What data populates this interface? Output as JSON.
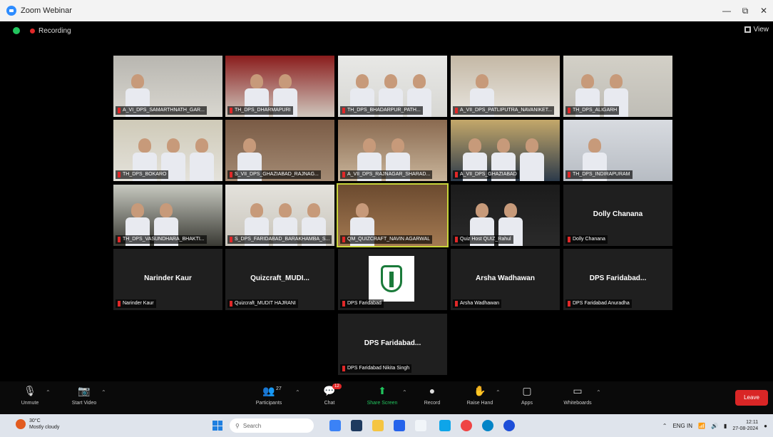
{
  "window": {
    "title": "Zoom Webinar",
    "controls": [
      "—",
      "⧉",
      "✕"
    ]
  },
  "topbar": {
    "recording_label": "Recording",
    "view_label": "View"
  },
  "tiles": [
    {
      "name": "A_VI_DPS_SAMARTHNATH_GAR...",
      "type": "video"
    },
    {
      "name": "TH_DPS_DHARMAPURI",
      "type": "video"
    },
    {
      "name": "TH_DPS_BHADARPUR_PATH...",
      "type": "video"
    },
    {
      "name": "A_VII_DPS_PATLIPUTRA_NAVANIKET...",
      "type": "video"
    },
    {
      "name": "TH_DPS_ALIGARH",
      "type": "video"
    },
    {
      "name": "TH_DPS_BOKARO",
      "type": "video"
    },
    {
      "name": "S_VII_DPS_GHAZIABAD_RAJNAG...",
      "type": "video"
    },
    {
      "name": "A_VII_DPS_RAJNAGAR_SHARAD...",
      "type": "video"
    },
    {
      "name": "A_VII_DPS_GHAZIABAD",
      "type": "video"
    },
    {
      "name": "TH_DPS_INDIRAPURAM",
      "type": "video"
    },
    {
      "name": "TH_DPS_VASUNDHARA_BHAKTI...",
      "type": "video"
    },
    {
      "name": "S_DPS_FARIDABAD_BARAKHAMBA_S...",
      "type": "video"
    },
    {
      "name": "QM_QUIZCRAFT_NAVIN AGARWAL",
      "type": "video",
      "active": true
    },
    {
      "name": "Quiz Host QUIZ_Rahul",
      "type": "video"
    },
    {
      "name": "Dolly Chanana",
      "type": "text",
      "display": "Dolly Chanana"
    },
    {
      "name": "Narinder Kaur",
      "type": "text",
      "display": "Narinder Kaur"
    },
    {
      "name": "Quizcraft_MUDIT HAJRANI",
      "type": "text",
      "display": "Quizcraft_MUDI..."
    },
    {
      "name": "DPS Faridabad",
      "type": "logo"
    },
    {
      "name": "Arsha Wadhawan",
      "type": "text",
      "display": "Arsha Wadhawan"
    },
    {
      "name": "DPS Faridabad Anuradha",
      "type": "text",
      "display": "DPS Faridabad..."
    },
    {
      "name": "DPS Faridabad Nikita Singh",
      "type": "text",
      "display": "DPS Faridabad..."
    }
  ],
  "toolbar": {
    "unmute": "Unmute",
    "start_video": "Start Video",
    "participants": "Participants",
    "participants_count": "27",
    "chat": "Chat",
    "chat_badge": "12",
    "share_screen": "Share Screen",
    "record": "Record",
    "raise_hand": "Raise Hand",
    "apps": "Apps",
    "whiteboards": "Whiteboards",
    "leave": "Leave"
  },
  "taskbar": {
    "weather_temp": "30°C",
    "weather_desc": "Mostly cloudy",
    "search_placeholder": "Search",
    "language": "ENG IN",
    "time": "12:11",
    "date": "27-08-2024"
  }
}
